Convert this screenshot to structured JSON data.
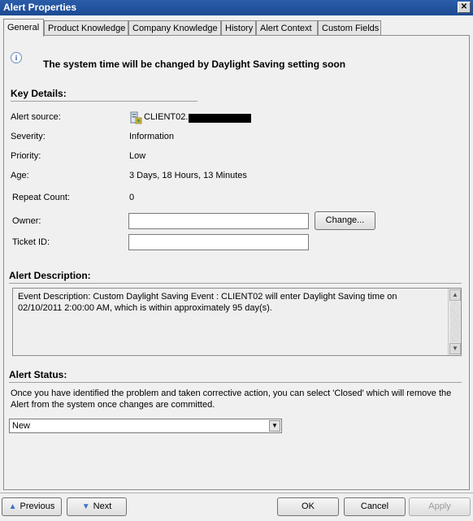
{
  "window": {
    "title": "Alert Properties",
    "close_glyph": "✕"
  },
  "tabs": [
    {
      "label": "General",
      "active": true
    },
    {
      "label": "Product Knowledge"
    },
    {
      "label": "Company Knowledge"
    },
    {
      "label": "History"
    },
    {
      "label": "Alert Context"
    },
    {
      "label": "Custom Fields"
    }
  ],
  "headline": "The system time will be changed by Daylight Saving setting soon",
  "key_details": {
    "title": "Key Details:",
    "alert_source_label": "Alert source:",
    "alert_source_value": "CLIENT02.",
    "severity_label": "Severity:",
    "severity_value": "Information",
    "priority_label": "Priority:",
    "priority_value": "Low",
    "age_label": "Age:",
    "age_value": "3 Days, 18 Hours, 13 Minutes",
    "repeat_count_label": "Repeat Count:",
    "repeat_count_value": "0",
    "owner_label": "Owner:",
    "owner_value": "",
    "change_button": "Change...",
    "ticket_id_label": "Ticket ID:",
    "ticket_id_value": ""
  },
  "alert_description": {
    "title": "Alert Description:",
    "text": "Event Description: Custom Daylight Saving Event : CLIENT02 will enter Daylight Saving time on 02/10/2011 2:00:00 AM, which is within approximately 95 day(s)."
  },
  "alert_status": {
    "title": "Alert Status:",
    "text": "Once you have identified the problem and taken corrective action, you can select 'Closed' which will remove the Alert from the system once changes are committed.",
    "selected": "New"
  },
  "footer": {
    "previous": "Previous",
    "next": "Next",
    "ok": "OK",
    "cancel": "Cancel",
    "apply": "Apply"
  },
  "colors": {
    "titlebar": "#1c4a92",
    "arrow": "#3b73c7"
  }
}
